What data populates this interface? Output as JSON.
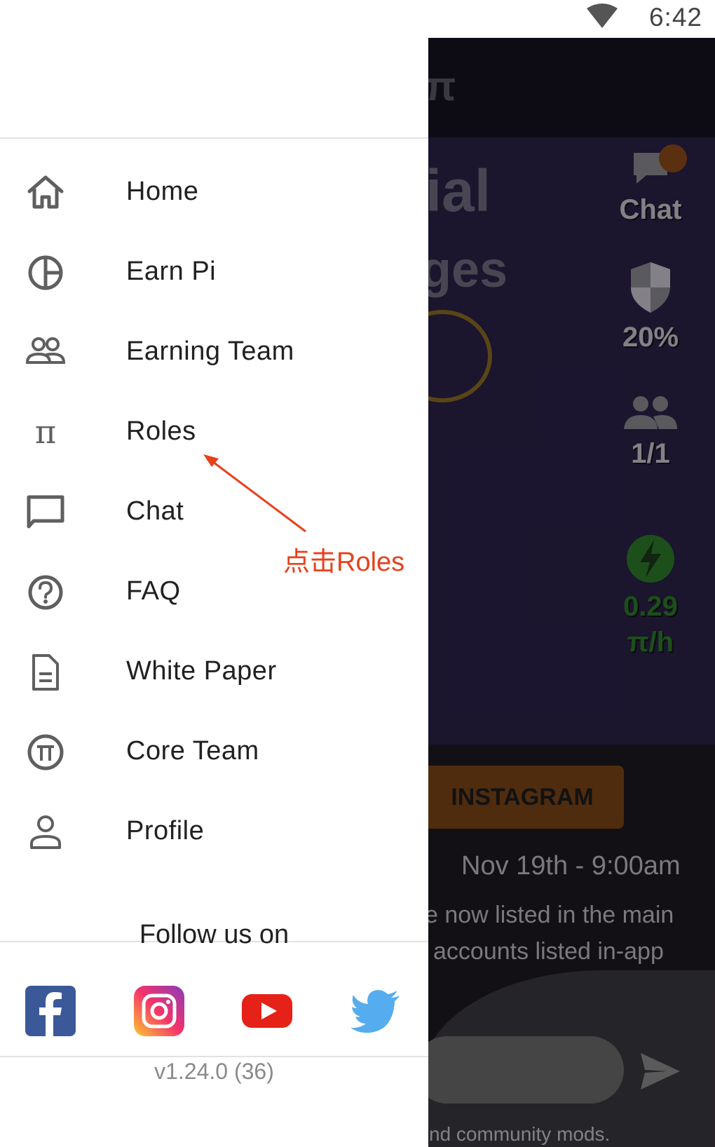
{
  "status_bar": {
    "time": "6:42"
  },
  "background_app": {
    "headline_fragment_1": "cial",
    "headline_fragment_2": "ages",
    "stats": {
      "chat_label": "Chat",
      "security_value": "20%",
      "team_value": "1/1",
      "rate_value": "0.29",
      "rate_unit": "π/h"
    },
    "instagram_button": "INSTAGRAM",
    "event_date": "Nov 19th - 9:00am",
    "text_line_1": "e now listed in the main",
    "text_line_2": "accounts listed in-app",
    "footer_fragment": "nd community mods."
  },
  "drawer": {
    "menu": [
      {
        "label": "Home",
        "icon": "home-icon"
      },
      {
        "label": "Earn Pi",
        "icon": "pie-icon"
      },
      {
        "label": "Earning Team",
        "icon": "team-icon"
      },
      {
        "label": "Roles",
        "icon": "pi-icon"
      },
      {
        "label": "Chat",
        "icon": "chat-icon"
      },
      {
        "label": "FAQ",
        "icon": "help-icon"
      },
      {
        "label": "White Paper",
        "icon": "document-icon"
      },
      {
        "label": "Core Team",
        "icon": "pi-circle-icon"
      },
      {
        "label": "Profile",
        "icon": "person-icon"
      }
    ],
    "follow_label": "Follow us on",
    "socials": [
      "facebook-icon",
      "instagram-icon",
      "youtube-icon",
      "twitter-icon"
    ],
    "version": "v1.24.0 (36)"
  },
  "annotation": {
    "text": "点击Roles",
    "color": "#e8401c"
  }
}
